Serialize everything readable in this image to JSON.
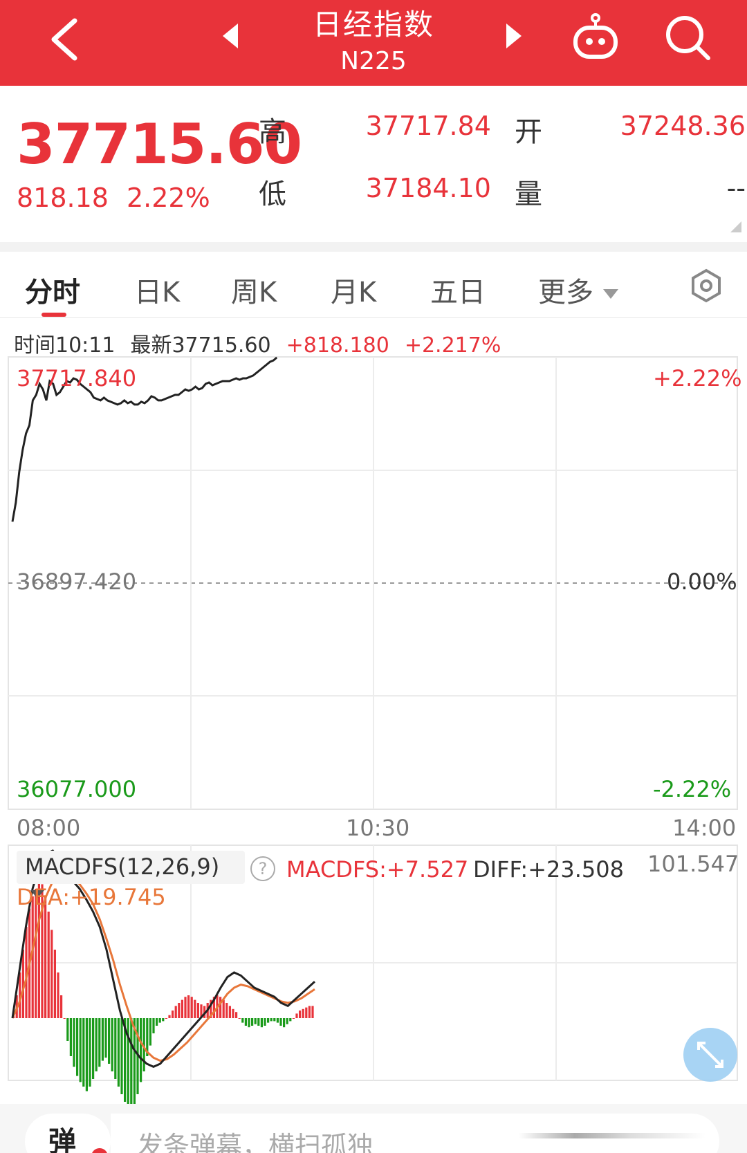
{
  "header": {
    "title": "日经指数",
    "subtitle": "N225"
  },
  "quote": {
    "price": "37715.60",
    "change": "818.18",
    "change_pct": "2.22%",
    "high_label": "高",
    "high_value": "37717.84",
    "open_label": "开",
    "open_value": "37248.36",
    "low_label": "低",
    "low_value": "37184.10",
    "volume_label": "量",
    "volume_value": "--"
  },
  "tabs": [
    {
      "label": "分时",
      "active": true
    },
    {
      "label": "日K"
    },
    {
      "label": "周K"
    },
    {
      "label": "月K"
    },
    {
      "label": "五日"
    },
    {
      "label": "更多"
    }
  ],
  "info_line": {
    "time": "时间10:11",
    "latest": "最新37715.60",
    "change": "+818.180",
    "change_pct": "+2.217%"
  },
  "chart_data": [
    {
      "type": "line",
      "y_top_label": "37717.840",
      "y_mid_label": "36897.420",
      "y_bottom_label": "36077.000",
      "pct_top_label": "+2.22%",
      "pct_mid_label": "0.00%",
      "pct_bottom_label": "-2.22%",
      "x_labels": [
        "08:00",
        "10:30",
        "14:00"
      ],
      "ylim": [
        36077.0,
        37717.84
      ],
      "colors": {
        "line": "#222222",
        "up": "#e8333a",
        "down": "#1a9a1a"
      },
      "x": [
        0,
        2,
        4,
        6,
        8,
        10,
        12,
        14,
        16,
        18,
        20,
        22,
        24,
        26,
        28,
        30,
        32,
        34,
        36,
        38,
        40,
        42,
        44,
        46,
        48,
        50,
        52,
        54,
        56,
        58,
        60,
        62,
        64,
        66,
        68,
        70,
        72,
        74,
        76,
        78,
        80,
        82,
        84,
        86,
        88,
        90,
        92,
        94,
        96,
        98,
        100,
        102,
        104,
        106,
        108,
        110,
        112,
        114,
        116,
        118,
        120,
        122,
        124,
        126,
        128,
        130,
        132,
        134,
        136,
        138,
        140,
        142,
        144,
        146,
        148,
        150,
        152,
        154,
        156,
        158,
        160,
        162,
        164,
        166,
        168,
        170,
        172,
        174,
        176,
        178,
        180
      ],
      "values": [
        37120,
        37190,
        37300,
        37380,
        37440,
        37470,
        37560,
        37580,
        37620,
        37600,
        37560,
        37630,
        37620,
        37580,
        37590,
        37610,
        37630,
        37625,
        37640,
        37635,
        37620,
        37610,
        37600,
        37590,
        37570,
        37565,
        37560,
        37570,
        37560,
        37555,
        37550,
        37545,
        37550,
        37560,
        37550,
        37555,
        37545,
        37545,
        37555,
        37550,
        37560,
        37575,
        37570,
        37560,
        37560,
        37565,
        37570,
        37575,
        37580,
        37580,
        37590,
        37600,
        37595,
        37600,
        37610,
        37600,
        37605,
        37620,
        37625,
        37615,
        37620,
        37625,
        37630,
        37630,
        37630,
        37635,
        37640,
        37635,
        37640,
        37640,
        37645,
        37650,
        37660,
        37670,
        37680,
        37690,
        37700,
        37705,
        37715.6
      ]
    },
    {
      "type": "bar",
      "title": "MACDFS(12,26,9)",
      "macdfs_label": "MACDFS:+7.527",
      "diff_label": "DIFF:+23.508",
      "dea_label": "DEA:+19.745",
      "y_top_label": "101.547",
      "colors": {
        "up": "#e8333a",
        "down": "#1a9a1a",
        "diff": "#222222",
        "dea": "#e8773a"
      },
      "histogram": [
        5,
        15,
        30,
        45,
        60,
        72,
        80,
        85,
        90,
        88,
        80,
        70,
        58,
        45,
        30,
        15,
        0,
        -15,
        -25,
        -32,
        -38,
        -42,
        -45,
        -48,
        -45,
        -40,
        -35,
        -32,
        -28,
        -26,
        -30,
        -35,
        -40,
        -45,
        -50,
        -55,
        -60,
        -62,
        -58,
        -50,
        -42,
        -35,
        -25,
        -18,
        -10,
        -5,
        -3,
        -2,
        0,
        2,
        5,
        8,
        10,
        12,
        14,
        15,
        14,
        12,
        10,
        9,
        8,
        10,
        12,
        14,
        15,
        14,
        12,
        10,
        8,
        6,
        4,
        0,
        -3,
        -5,
        -6,
        -5,
        -4,
        -5,
        -6,
        -5,
        -3,
        -2,
        -2,
        -3,
        -5,
        -6,
        -4,
        -2,
        0,
        3,
        5,
        6,
        7,
        8,
        8
      ],
      "diff": [
        0,
        30,
        60,
        85,
        100,
        108,
        110,
        105,
        95,
        90,
        85,
        78,
        70,
        60,
        45,
        25,
        5,
        -10,
        -20,
        -26,
        -30,
        -32,
        -30,
        -25,
        -20,
        -15,
        -10,
        -5,
        0,
        5,
        12,
        20,
        27,
        30,
        28,
        24,
        20,
        18,
        16,
        14,
        10,
        8,
        12,
        16,
        20,
        24
      ],
      "dea": [
        0,
        10,
        25,
        45,
        65,
        80,
        90,
        95,
        95,
        92,
        88,
        82,
        75,
        65,
        52,
        38,
        22,
        8,
        -5,
        -15,
        -22,
        -26,
        -28,
        -27,
        -24,
        -20,
        -16,
        -11,
        -6,
        -1,
        4,
        10,
        16,
        20,
        22,
        21,
        19,
        17,
        15,
        13,
        11,
        10,
        11,
        13,
        16,
        19
      ]
    }
  ],
  "bottom": {
    "danmu_button": "弹",
    "input_placeholder": "发条弹幕，横扫孤独"
  }
}
